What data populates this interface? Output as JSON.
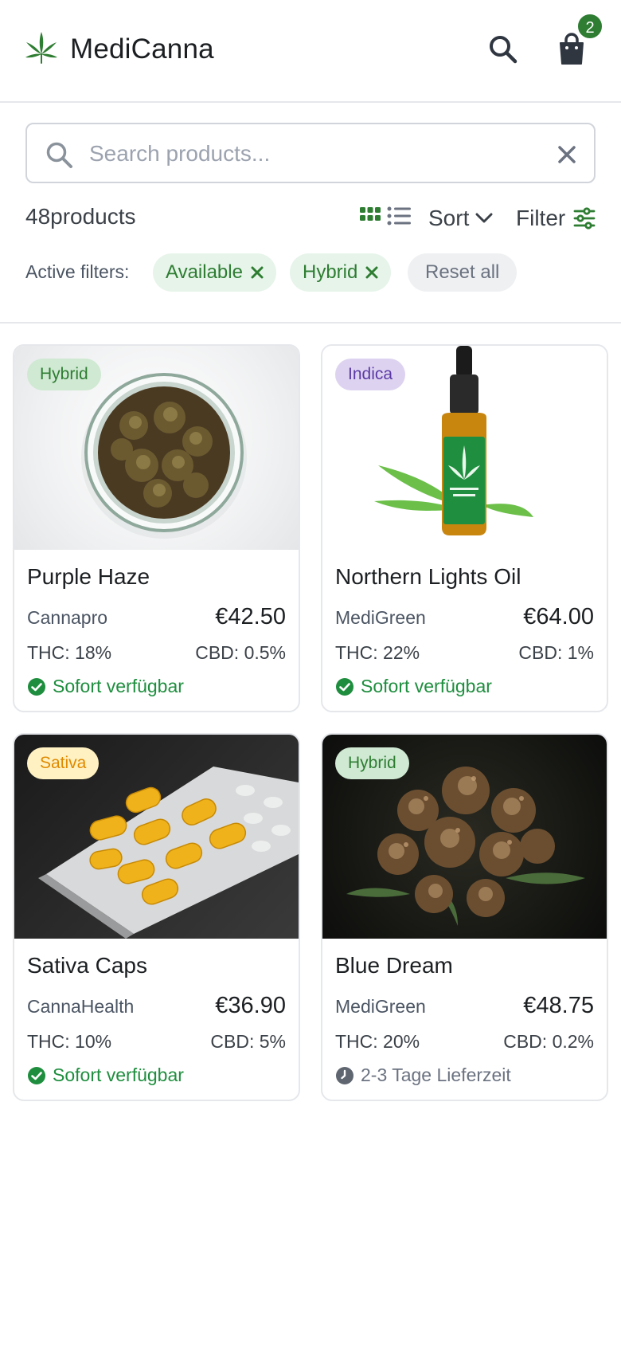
{
  "app": {
    "name": "MediCanna",
    "cart_count": "2"
  },
  "search": {
    "placeholder": "Search products..."
  },
  "toolbar": {
    "count": "48products",
    "sort_label": "Sort",
    "filter_label": "Filter"
  },
  "filters": {
    "label": "Active filters:",
    "chips": [
      "Available",
      "Hybrid"
    ],
    "reset_label": "Reset all"
  },
  "colors": {
    "accent": "#2e7d32",
    "available": "#1e8e3e"
  },
  "products": [
    {
      "name": "Purple Haze",
      "type": "Hybrid",
      "brand": "Cannapro",
      "price": "€42.50",
      "thc": "THC: 18%",
      "cbd": "CBD: 0.5%",
      "availability": "Sofort verfügbar"
    },
    {
      "name": "Northern Lights Oil",
      "type": "Indica",
      "brand": "MediGreen",
      "price": "€64.00",
      "thc": "THC: 22%",
      "cbd": "CBD: 1%",
      "availability": "Sofort verfügbar"
    },
    {
      "name": "Sativa Caps",
      "type": "Sativa",
      "brand": "CannaHealth",
      "price": "€36.90",
      "thc": "THC: 10%",
      "cbd": "CBD: 5%",
      "availability": "Sofort verfügbar"
    },
    {
      "name": "Blue Dream",
      "type": "Hybrid",
      "brand": "MediGreen",
      "price": "€48.75",
      "thc": "THC: 20%",
      "cbd": "CBD: 0.2%",
      "availability": "2-3 Tage Lieferzeit"
    }
  ]
}
